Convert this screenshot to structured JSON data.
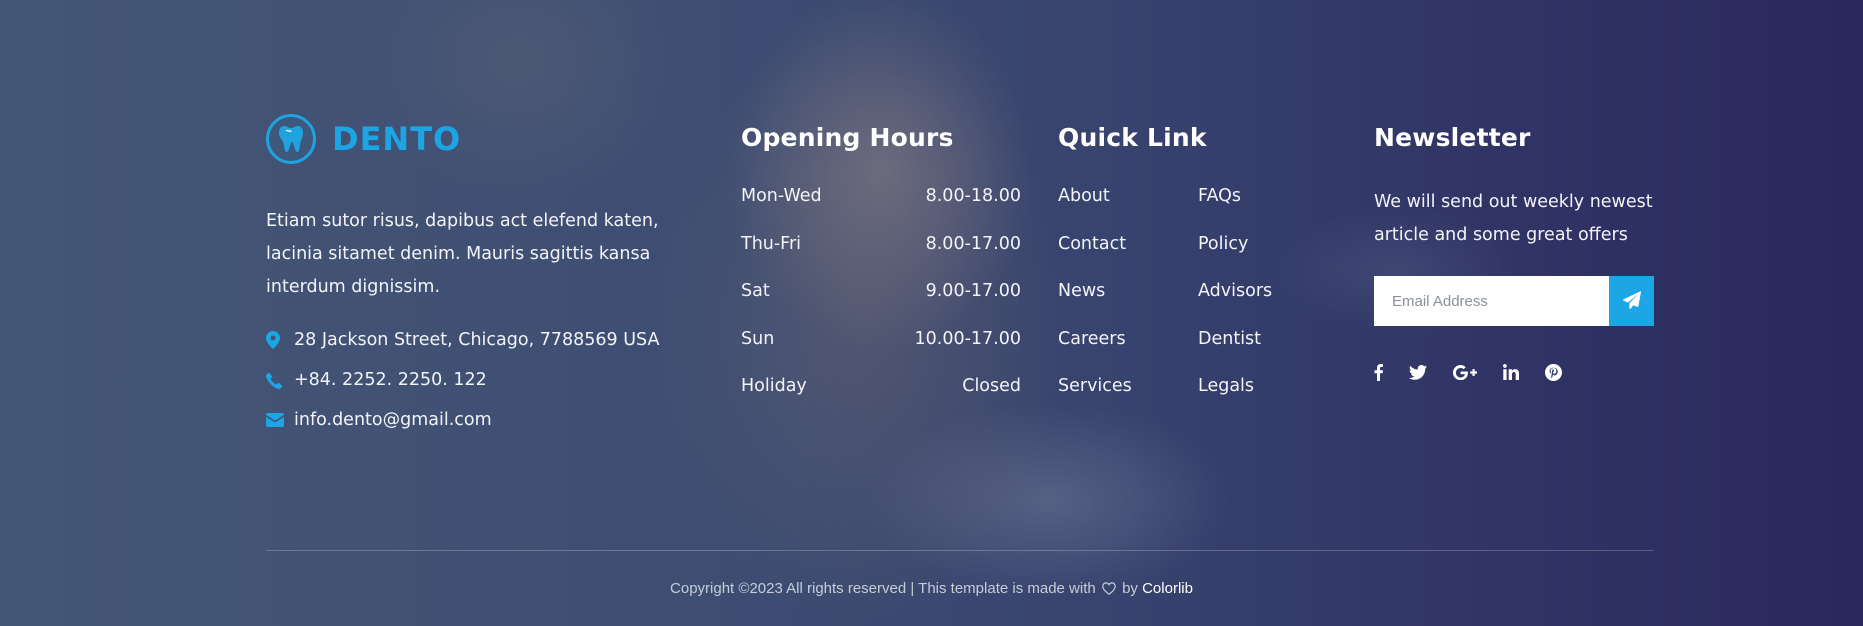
{
  "brand": {
    "name": "DENTO",
    "description": "Etiam sutor risus, dapibus act elefend katen, lacinia sitamet denim. Mauris sagittis kansa interdum dignissim.",
    "address": "28 Jackson Street, Chicago, 7788569 USA",
    "phone": "+84. 2252. 2250. 122",
    "email": "info.dento@gmail.com",
    "accent_color": "#1ca5e4"
  },
  "hours": {
    "title": "Opening Hours",
    "rows": [
      {
        "day": "Mon-Wed",
        "time": "8.00-18.00"
      },
      {
        "day": "Thu-Fri",
        "time": "8.00-17.00"
      },
      {
        "day": "Sat",
        "time": "9.00-17.00"
      },
      {
        "day": "Sun",
        "time": "10.00-17.00"
      },
      {
        "day": "Holiday",
        "time": "Closed"
      }
    ]
  },
  "links": {
    "title": "Quick Link",
    "items": [
      "About",
      "FAQs",
      "Contact",
      "Policy",
      "News",
      "Advisors",
      "Careers",
      "Dentist",
      "Services",
      "Legals"
    ]
  },
  "newsletter": {
    "title": "Newsletter",
    "text": "We will send out weekly newest article and some great offers",
    "placeholder": "Email Address",
    "button_icon": "paper-plane-icon",
    "social": [
      "facebook-icon",
      "twitter-icon",
      "google-plus-icon",
      "linkedin-icon",
      "pinterest-icon"
    ]
  },
  "copyright": {
    "text_before": "Copyright ©2023 All rights reserved | This template is made with",
    "text_by": "by",
    "author": "Colorlib"
  }
}
